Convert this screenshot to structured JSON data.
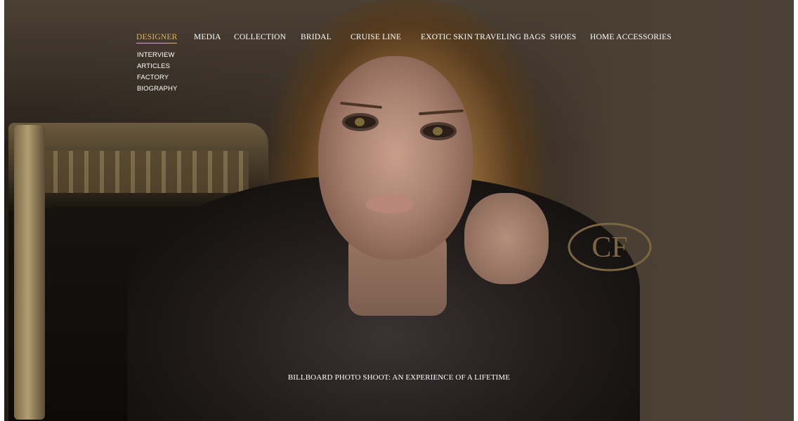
{
  "nav": {
    "items": [
      {
        "label": "DESIGNER",
        "active": true
      },
      {
        "label": "MEDIA"
      },
      {
        "label": "COLLECTION"
      },
      {
        "label": "BRIDAL"
      },
      {
        "label": "CRUISE LINE"
      },
      {
        "label": "EXOTIC SKIN TRAVELING BAGS"
      },
      {
        "label": "SHOES"
      },
      {
        "label": "HOME ACCESSORIES"
      }
    ],
    "designer_submenu": [
      "INTERVIEW",
      "ARTICLES",
      "FACTORY",
      "BIOGRAPHY"
    ]
  },
  "hero": {
    "caption": "BILLBOARD PHOTO SHOOT: AN EXPERIENCE OF A LIFETIME",
    "logo_text": "CF"
  },
  "colors": {
    "accent": "#e0b468",
    "logo": "#7a6642",
    "nav_text": "#ffffff"
  }
}
